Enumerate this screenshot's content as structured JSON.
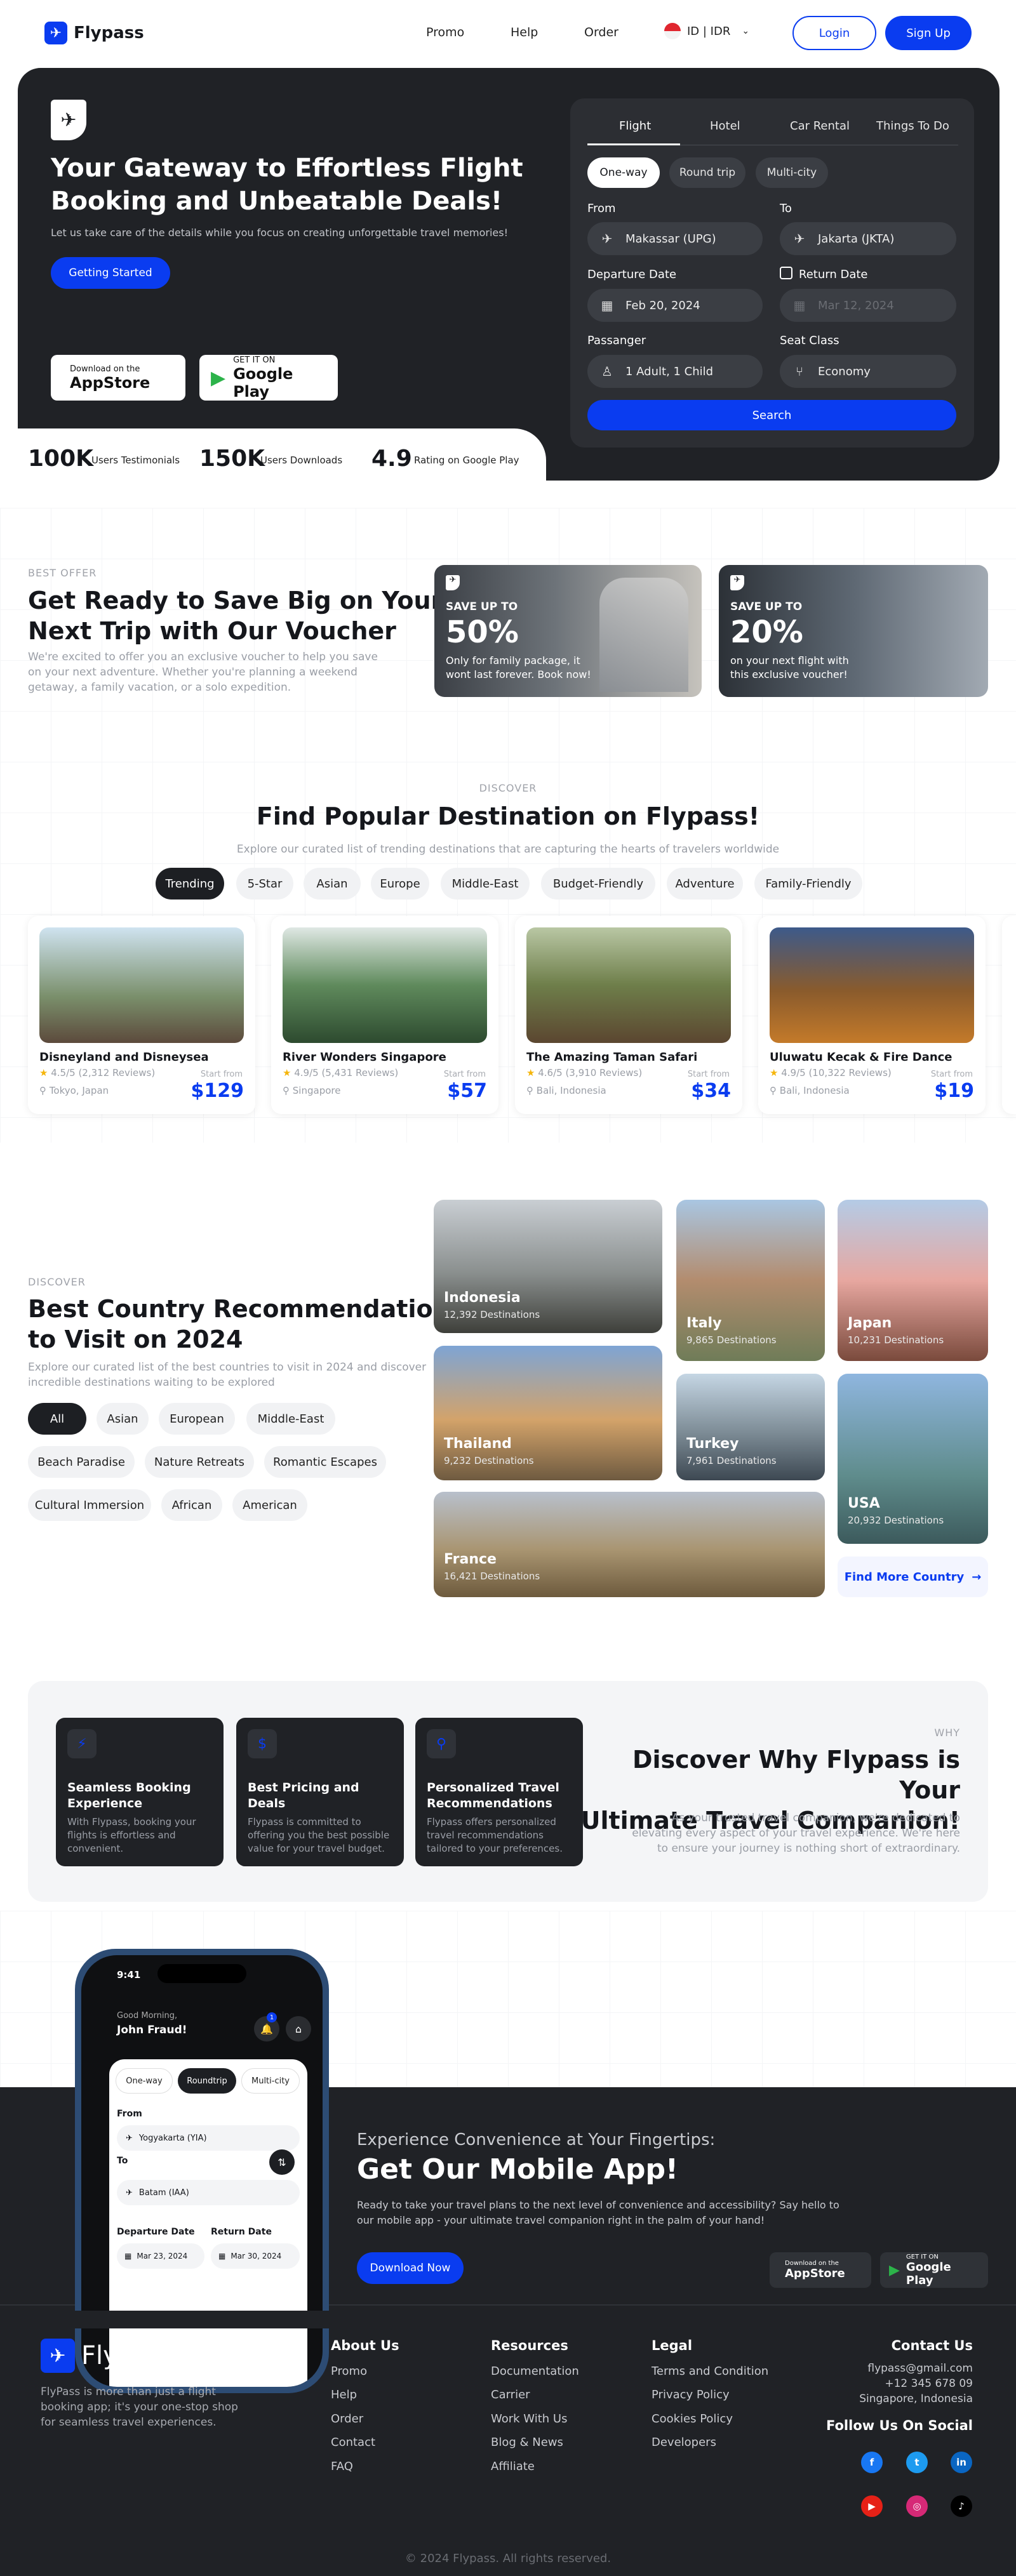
{
  "nav": {
    "brand": "Flypass",
    "links": [
      "Promo",
      "Help",
      "Order"
    ],
    "locale": "ID | IDR",
    "login": "Login",
    "signup": "Sign Up"
  },
  "hero": {
    "title_line1": "Your Gateway to Effortless Flight",
    "title_line2": "Booking and Unbeatable Deals!",
    "subtitle": "Let us take care of the details while you focus on creating unforgettable travel memories!",
    "cta": "Getting Started",
    "appstore_small": "Download on the",
    "appstore_large": "AppStore",
    "play_small": "GET IT ON",
    "play_large": "Google Play"
  },
  "search": {
    "tabs": [
      "Flight",
      "Hotel",
      "Car Rental",
      "Things To Do"
    ],
    "trip_types": [
      "One-way",
      "Round trip",
      "Multi-city"
    ],
    "from_label": "From",
    "from_value": "Makassar (UPG)",
    "to_label": "To",
    "to_value": "Jakarta (JKTA)",
    "departure_label": "Departure Date",
    "departure_value": "Feb 20, 2024",
    "return_label": "Return Date",
    "return_value": "Mar 12, 2024",
    "passenger_label": "Passanger",
    "passenger_value": "1 Adult, 1 Child",
    "seat_label": "Seat Class",
    "seat_value": "Economy",
    "search_button": "Search"
  },
  "stats": [
    {
      "num": "100K",
      "label": "Users Testimonials"
    },
    {
      "num": "150K",
      "label": "Users Downloads"
    },
    {
      "num": "4.9",
      "label": "Rating on Google Play"
    }
  ],
  "offer": {
    "eyebrow": "BEST OFFER",
    "title_line1": "Get Ready to Save Big on Your",
    "title_line2": "Next Trip with Our Voucher",
    "desc_line1": "We're excited to offer you an exclusive voucher to help you save",
    "desc_line2": "on your next adventure. Whether you're planning a weekend",
    "desc_line3": "getaway, a family vacation, or a solo expedition.",
    "vouchers": [
      {
        "label": "SAVE UP TO",
        "pct": "50%",
        "note1": "Only for family package, it",
        "note2": "wont last forever. Book now!"
      },
      {
        "label": "SAVE UP TO",
        "pct": "20%",
        "note1": "on your next flight with",
        "note2": "this exclusive voucher!"
      }
    ]
  },
  "popular": {
    "eyebrow": "DISCOVER",
    "title": "Find Popular Destination on Flypass!",
    "subtitle": "Explore our curated list of trending destinations that are capturing the hearts of travelers worldwide",
    "filters": [
      "Trending",
      "5-Star",
      "Asian",
      "Europe",
      "Middle-East",
      "Budget-Friendly",
      "Adventure",
      "Family-Friendly"
    ],
    "cards": [
      {
        "name": "Disneyland and Disneysea",
        "rating": "4.5/5 (2,312 Reviews)",
        "loc": "Tokyo, Japan",
        "start": "Start from",
        "price": "$129"
      },
      {
        "name": "River Wonders Singapore",
        "rating": "4.9/5 (5,431 Reviews)",
        "loc": "Singapore",
        "start": "Start from",
        "price": "$57"
      },
      {
        "name": "The Amazing Taman Safari",
        "rating": "4.6/5 (3,910 Reviews)",
        "loc": "Bali, Indonesia",
        "start": "Start from",
        "price": "$34"
      },
      {
        "name": "Uluwatu Kecak & Fire Dance",
        "rating": "4.9/5 (10,322 Reviews)",
        "loc": "Bali, Indonesia",
        "start": "Start from",
        "price": "$19"
      }
    ]
  },
  "country": {
    "eyebrow": "DISCOVER",
    "title_line1": "Best Country Recommendation",
    "title_line2": "to Visit on 2024",
    "desc_line1": "Explore our curated list of the best countries to visit in 2024 and discover",
    "desc_line2": "incredible destinations waiting to be explored",
    "filters": [
      "All",
      "Asian",
      "European",
      "Middle-East",
      "Beach Paradise",
      "Nature Retreats",
      "Romantic Escapes",
      "Cultural Immersion",
      "African",
      "American"
    ],
    "tiles": [
      {
        "name": "Indonesia",
        "dest": "12,392 Destinations"
      },
      {
        "name": "Italy",
        "dest": "9,865 Destinations"
      },
      {
        "name": "Japan",
        "dest": "10,231 Destinations"
      },
      {
        "name": "Thailand",
        "dest": "9,232 Destinations"
      },
      {
        "name": "Turkey",
        "dest": "7,961 Destinations"
      },
      {
        "name": "USA",
        "dest": "20,932 Destinations"
      },
      {
        "name": "France",
        "dest": "16,421 Destinations"
      }
    ],
    "more": "Find More Country"
  },
  "why": {
    "eyebrow": "WHY",
    "title_line1": "Discover Why Flypass is Your",
    "title_line2": "Ultimate Travel Companion!",
    "desc_line1": "As your trusted travel companion, we're dedicated to",
    "desc_line2": "elevating every aspect of your travel experience. We're here",
    "desc_line3": "to ensure your journey is nothing short of extraordinary.",
    "features": [
      {
        "title": "Seamless Booking Experience",
        "desc": "With Flypass, booking your flights is effortless and convenient."
      },
      {
        "title": "Best Pricing and Deals",
        "desc": "Flypass is committed to offering you the best possible value for your travel budget."
      },
      {
        "title": "Personalized Travel Recommendations",
        "desc": "Flypass offers personalized travel recommendations tailored to your preferences."
      }
    ]
  },
  "phone": {
    "time": "9:41",
    "greet": "Good Morning,",
    "user": "John Fraud!",
    "badge": "1",
    "tabs": [
      "One-way",
      "Roundtrip",
      "Multi-city"
    ],
    "from_label": "From",
    "from_value": "Yogyakarta (YIA)",
    "to_label": "To",
    "to_value": "Batam (IAA)",
    "dep_label": "Departure Date",
    "dep_value": "Mar 23, 2024",
    "ret_label": "Return Date",
    "ret_value": "Mar 30, 2024"
  },
  "app": {
    "eyebrow": "Experience Convenience at Your Fingertips:",
    "title": "Get Our Mobile App!",
    "desc_line1": "Ready to take your travel plans to the next level of convenience and accessibility? Say hello to",
    "desc_line2": "our mobile app - your ultimate travel companion right in the palm of your hand!",
    "cta": "Download Now",
    "appstore_small": "Download on the",
    "appstore_large": "AppStore",
    "play_small": "GET IT ON",
    "play_large": "Google Play"
  },
  "footer": {
    "brand": "Flypass",
    "about_line1": "FlyPass is more than just a flight",
    "about_line2": "booking app; it's your one-stop shop",
    "about_line3": "for seamless travel experiences.",
    "cols": [
      {
        "head": "About Us",
        "items": [
          "Promo",
          "Help",
          "Order",
          "Contact",
          "FAQ"
        ]
      },
      {
        "head": "Resources",
        "items": [
          "Documentation",
          "Carrier",
          "Work With Us",
          "Blog & News",
          "Affiliate"
        ]
      },
      {
        "head": "Legal",
        "items": [
          "Terms and Condition",
          "Privacy Policy",
          "Cookies Policy",
          "Developers"
        ]
      }
    ],
    "contact_head": "Contact Us",
    "email": "flypass@gmail.com",
    "phone": "+12 345 678 09",
    "city": "Singapore, Indonesia",
    "follow": "Follow Us On Social",
    "copyright": "© 2024 Flypass. All rights reserved."
  },
  "colors": {
    "accent": "#0a3cf0",
    "dark": "#202226"
  }
}
